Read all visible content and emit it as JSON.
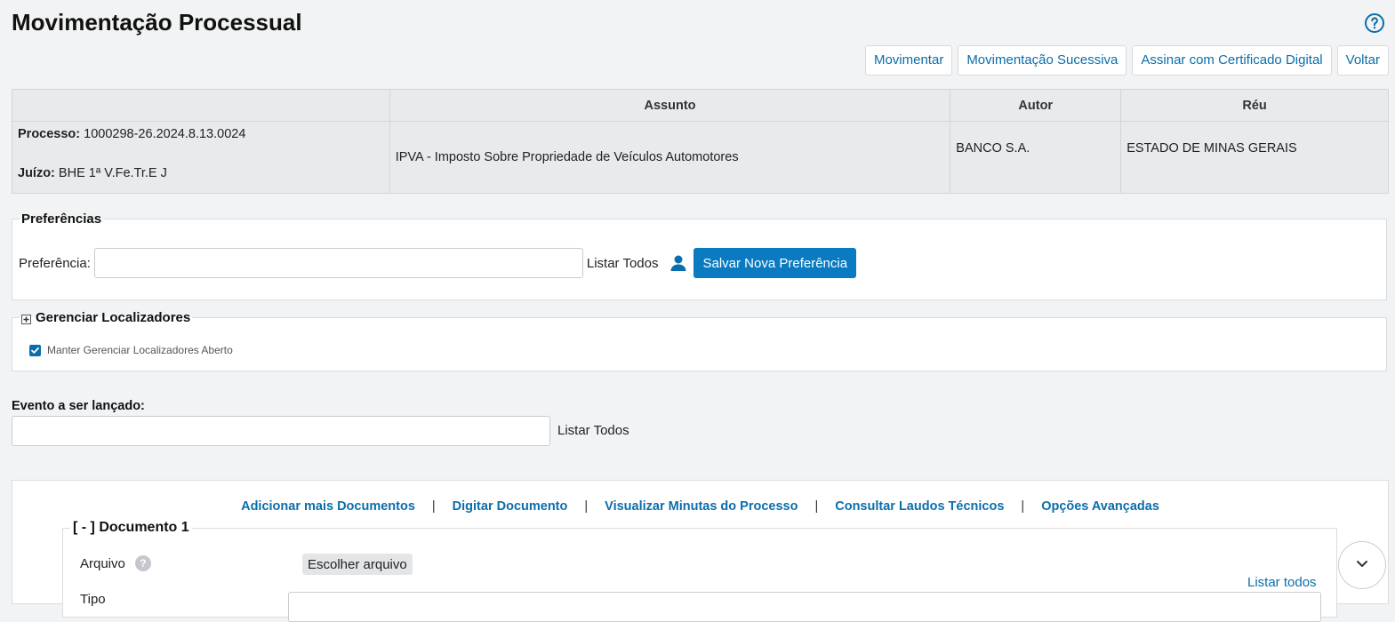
{
  "page": {
    "title": "Movimentação Processual"
  },
  "help": {
    "icon": "question-circle-icon"
  },
  "actions": [
    {
      "label": "Movimentar"
    },
    {
      "label": "Movimentação Sucessiva"
    },
    {
      "label": "Assinar com Certificado Digital"
    },
    {
      "label": "Voltar"
    }
  ],
  "process_table": {
    "headers": {
      "assunto": "Assunto",
      "autor": "Autor",
      "reu": "Réu"
    },
    "processo_label": "Processo:",
    "processo_value": "1000298-26.2024.8.13.0024",
    "juizo_label": "Juízo:",
    "juizo_value": "BHE 1ª V.Fe.Tr.E J",
    "assunto": "IPVA - Imposto Sobre Propriedade de Veículos Automotores",
    "autor": "BANCO S.A.",
    "reu": "ESTADO DE MINAS GERAIS"
  },
  "preferences": {
    "legend": "Preferências",
    "label": "Preferência:",
    "value": "",
    "list_all": "Listar Todos",
    "icon": "person-icon",
    "save_button": "Salvar Nova Preferência"
  },
  "locators": {
    "legend": "Gerenciar Localizadores",
    "icon": "plus-square-icon",
    "keep_open_label": "Manter Gerenciar Localizadores Aberto",
    "keep_open_checked": true
  },
  "event": {
    "label": "Evento a ser lançado:",
    "value": "",
    "list_all": "Listar Todos"
  },
  "documents": {
    "links": [
      {
        "label": "Adicionar mais Documentos"
      },
      {
        "label": "Digitar Documento"
      },
      {
        "label": "Visualizar Minutas do Processo"
      },
      {
        "label": "Consultar Laudos Técnicos"
      },
      {
        "label": "Opções Avançadas"
      }
    ],
    "separator": "|",
    "doc1": {
      "legend": "[ - ] Documento 1",
      "file_label": "Arquivo",
      "info_icon": "?",
      "choose_file": "Escolher arquivo",
      "list_all": "Listar todos",
      "type_label": "Tipo",
      "type_value": ""
    }
  },
  "scroll": {
    "icon": "chevron-down-icon"
  },
  "colors": {
    "accent": "#0a7bc0",
    "link": "#0a6eac",
    "background": "#f2f3f4"
  }
}
